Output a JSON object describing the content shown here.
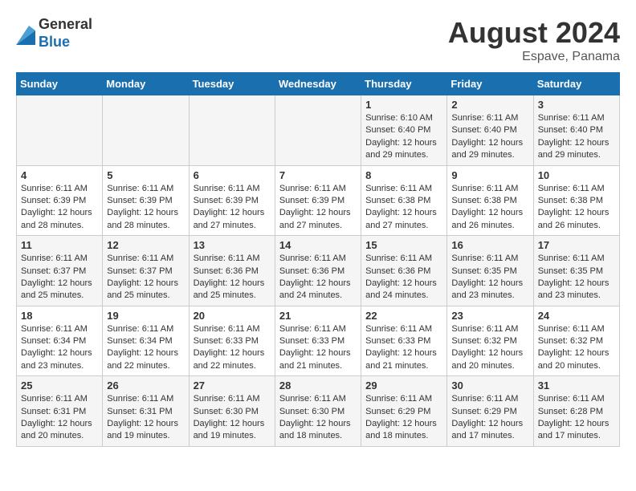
{
  "header": {
    "logo_general": "General",
    "logo_blue": "Blue",
    "month_year": "August 2024",
    "location": "Espave, Panama"
  },
  "days_of_week": [
    "Sunday",
    "Monday",
    "Tuesday",
    "Wednesday",
    "Thursday",
    "Friday",
    "Saturday"
  ],
  "weeks": [
    [
      {
        "day": "",
        "info": ""
      },
      {
        "day": "",
        "info": ""
      },
      {
        "day": "",
        "info": ""
      },
      {
        "day": "",
        "info": ""
      },
      {
        "day": "1",
        "info": "Sunrise: 6:10 AM\nSunset: 6:40 PM\nDaylight: 12 hours and 29 minutes."
      },
      {
        "day": "2",
        "info": "Sunrise: 6:11 AM\nSunset: 6:40 PM\nDaylight: 12 hours and 29 minutes."
      },
      {
        "day": "3",
        "info": "Sunrise: 6:11 AM\nSunset: 6:40 PM\nDaylight: 12 hours and 29 minutes."
      }
    ],
    [
      {
        "day": "4",
        "info": "Sunrise: 6:11 AM\nSunset: 6:39 PM\nDaylight: 12 hours and 28 minutes."
      },
      {
        "day": "5",
        "info": "Sunrise: 6:11 AM\nSunset: 6:39 PM\nDaylight: 12 hours and 28 minutes."
      },
      {
        "day": "6",
        "info": "Sunrise: 6:11 AM\nSunset: 6:39 PM\nDaylight: 12 hours and 27 minutes."
      },
      {
        "day": "7",
        "info": "Sunrise: 6:11 AM\nSunset: 6:39 PM\nDaylight: 12 hours and 27 minutes."
      },
      {
        "day": "8",
        "info": "Sunrise: 6:11 AM\nSunset: 6:38 PM\nDaylight: 12 hours and 27 minutes."
      },
      {
        "day": "9",
        "info": "Sunrise: 6:11 AM\nSunset: 6:38 PM\nDaylight: 12 hours and 26 minutes."
      },
      {
        "day": "10",
        "info": "Sunrise: 6:11 AM\nSunset: 6:38 PM\nDaylight: 12 hours and 26 minutes."
      }
    ],
    [
      {
        "day": "11",
        "info": "Sunrise: 6:11 AM\nSunset: 6:37 PM\nDaylight: 12 hours and 25 minutes."
      },
      {
        "day": "12",
        "info": "Sunrise: 6:11 AM\nSunset: 6:37 PM\nDaylight: 12 hours and 25 minutes."
      },
      {
        "day": "13",
        "info": "Sunrise: 6:11 AM\nSunset: 6:36 PM\nDaylight: 12 hours and 25 minutes."
      },
      {
        "day": "14",
        "info": "Sunrise: 6:11 AM\nSunset: 6:36 PM\nDaylight: 12 hours and 24 minutes."
      },
      {
        "day": "15",
        "info": "Sunrise: 6:11 AM\nSunset: 6:36 PM\nDaylight: 12 hours and 24 minutes."
      },
      {
        "day": "16",
        "info": "Sunrise: 6:11 AM\nSunset: 6:35 PM\nDaylight: 12 hours and 23 minutes."
      },
      {
        "day": "17",
        "info": "Sunrise: 6:11 AM\nSunset: 6:35 PM\nDaylight: 12 hours and 23 minutes."
      }
    ],
    [
      {
        "day": "18",
        "info": "Sunrise: 6:11 AM\nSunset: 6:34 PM\nDaylight: 12 hours and 23 minutes."
      },
      {
        "day": "19",
        "info": "Sunrise: 6:11 AM\nSunset: 6:34 PM\nDaylight: 12 hours and 22 minutes."
      },
      {
        "day": "20",
        "info": "Sunrise: 6:11 AM\nSunset: 6:33 PM\nDaylight: 12 hours and 22 minutes."
      },
      {
        "day": "21",
        "info": "Sunrise: 6:11 AM\nSunset: 6:33 PM\nDaylight: 12 hours and 21 minutes."
      },
      {
        "day": "22",
        "info": "Sunrise: 6:11 AM\nSunset: 6:33 PM\nDaylight: 12 hours and 21 minutes."
      },
      {
        "day": "23",
        "info": "Sunrise: 6:11 AM\nSunset: 6:32 PM\nDaylight: 12 hours and 20 minutes."
      },
      {
        "day": "24",
        "info": "Sunrise: 6:11 AM\nSunset: 6:32 PM\nDaylight: 12 hours and 20 minutes."
      }
    ],
    [
      {
        "day": "25",
        "info": "Sunrise: 6:11 AM\nSunset: 6:31 PM\nDaylight: 12 hours and 20 minutes."
      },
      {
        "day": "26",
        "info": "Sunrise: 6:11 AM\nSunset: 6:31 PM\nDaylight: 12 hours and 19 minutes."
      },
      {
        "day": "27",
        "info": "Sunrise: 6:11 AM\nSunset: 6:30 PM\nDaylight: 12 hours and 19 minutes."
      },
      {
        "day": "28",
        "info": "Sunrise: 6:11 AM\nSunset: 6:30 PM\nDaylight: 12 hours and 18 minutes."
      },
      {
        "day": "29",
        "info": "Sunrise: 6:11 AM\nSunset: 6:29 PM\nDaylight: 12 hours and 18 minutes."
      },
      {
        "day": "30",
        "info": "Sunrise: 6:11 AM\nSunset: 6:29 PM\nDaylight: 12 hours and 17 minutes."
      },
      {
        "day": "31",
        "info": "Sunrise: 6:11 AM\nSunset: 6:28 PM\nDaylight: 12 hours and 17 minutes."
      }
    ]
  ]
}
